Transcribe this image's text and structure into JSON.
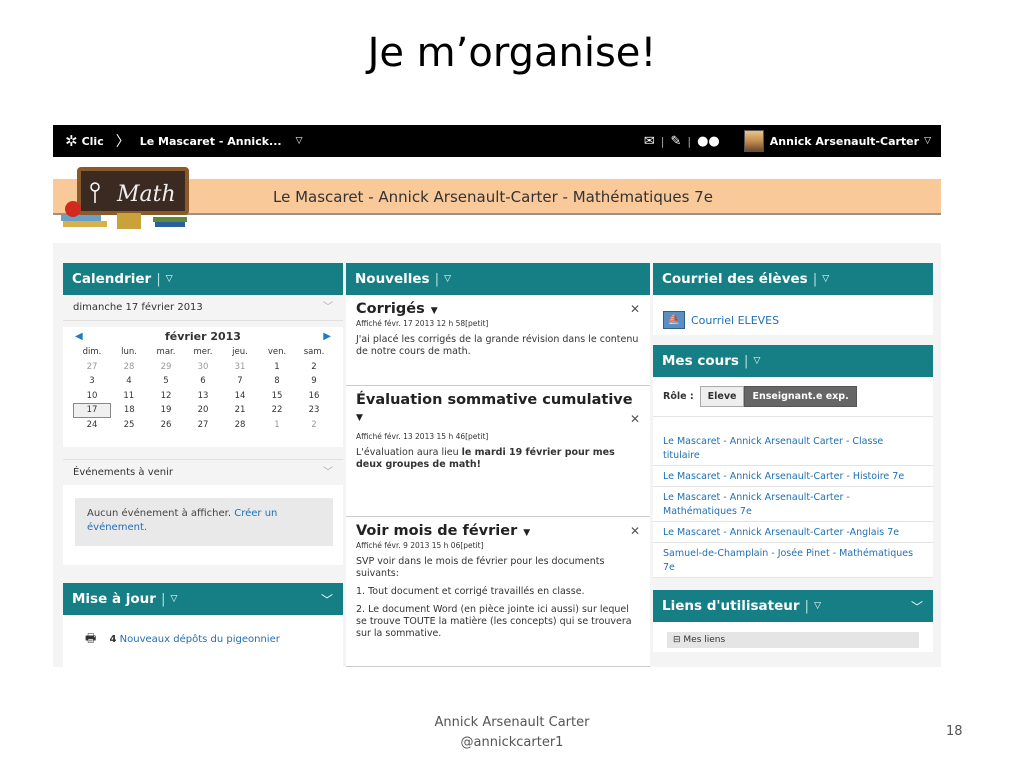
{
  "slide": {
    "title": "Je m’organise!",
    "footer_line1": "Annick Arsenault Carter",
    "footer_line2": "@annickcarter1",
    "page_number": "18"
  },
  "topnav": {
    "brand": "Clic",
    "course": "Le Mascaret - Annick...",
    "user": "Annick Arsenault-Carter",
    "icons": [
      "mail-icon",
      "notes-icon",
      "chat-icon"
    ]
  },
  "banner": {
    "title": "Le Mascaret - Annick Arsenault-Carter - Mathématiques 7e",
    "logo_text": "Math"
  },
  "calendar": {
    "title": "Calendrier",
    "selected_date": "dimanche 17 février 2013",
    "month": "février 2013",
    "weekdays": [
      "dim.",
      "lun.",
      "mar.",
      "mer.",
      "jeu.",
      "ven.",
      "sam."
    ],
    "weeks": [
      [
        "27",
        "28",
        "29",
        "30",
        "31",
        "1",
        "2"
      ],
      [
        "3",
        "4",
        "5",
        "6",
        "7",
        "8",
        "9"
      ],
      [
        "10",
        "11",
        "12",
        "13",
        "14",
        "15",
        "16"
      ],
      [
        "17",
        "18",
        "19",
        "20",
        "21",
        "22",
        "23"
      ],
      [
        "24",
        "25",
        "26",
        "27",
        "28",
        "1",
        "2"
      ]
    ],
    "events_title": "Événements à venir",
    "no_events": "Aucun événement à afficher.",
    "create_event": "Créer un événement."
  },
  "mise_a_jour": {
    "title": "Mise à jour",
    "count": "4",
    "link": "Nouveaux dépôts du pigeonnier"
  },
  "nouvelles": {
    "title": "Nouvelles",
    "items": [
      {
        "title": "Corrigés",
        "meta": "Affiché févr. 17 2013 12 h 58[petit]",
        "body": "J'ai placé les corrigés de la grande révision dans le contenu de notre cours de math."
      },
      {
        "title": "Évaluation sommative cumulative",
        "meta": "Affiché févr. 13 2013 15 h 46[petit]",
        "body_before": "L'évaluation aura lieu ",
        "body_bold": "le mardi 19 février pour mes deux groupes de math!"
      },
      {
        "title": "Voir mois de février",
        "meta": "Affiché févr. 9 2013 15 h 06[petit]",
        "body": "SVP voir dans le mois de février pour les documents suivants:",
        "body2": "1.  Tout document et corrigé travaillés en classe.",
        "body3": "2.  Le document Word (en pièce jointe ici aussi) sur lequel se trouve TOUTE la matière (les concepts) qui se trouvera sur la sommative."
      }
    ]
  },
  "courriel": {
    "title": "Courriel des élèves",
    "link": "Courriel ELEVES"
  },
  "mes_cours": {
    "title": "Mes cours",
    "role_label": "Rôle :",
    "role_eleve": "Eleve",
    "role_enseignant": "Enseignant.e exp.",
    "courses": [
      "Le Mascaret - Annick Arsenault Carter - Classe titulaire",
      "Le Mascaret - Annick Arsenault-Carter - Histoire 7e",
      "Le Mascaret - Annick Arsenault-Carter - Mathématiques 7e",
      "Le Mascaret - Annick Arsenault-Carter -Anglais 7e",
      "Samuel-de-Champlain - Josée Pinet - Mathématiques 7e"
    ]
  },
  "liens": {
    "title": "Liens d'utilisateur",
    "first": "Mes liens"
  }
}
